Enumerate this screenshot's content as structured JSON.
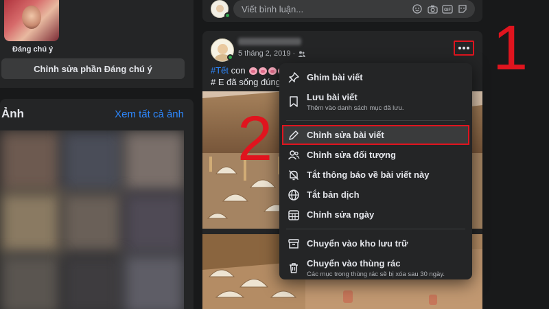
{
  "left": {
    "featured_label": "Đáng chú ý",
    "edit_featured_button": "Chỉnh sửa phần Đáng chú ý",
    "photos_title": "Ảnh",
    "see_all_photos": "Xem tất cả ảnh"
  },
  "prev_post": {
    "comment_placeholder": "Viết bình luận..."
  },
  "post": {
    "date": "5 tháng 2, 2019 ·",
    "text_hashtag": "#Tết",
    "text_line1_rest": " con",
    "text_line2": "# E đã sống đúng v",
    "more_icon": "more-horizontal-icon"
  },
  "menu": {
    "items": [
      {
        "label": "Ghim bài viết",
        "icon": "pin-icon"
      },
      {
        "label": "Lưu bài viết",
        "sub": "Thêm vào danh sách mục đã lưu.",
        "icon": "bookmark-icon"
      },
      {
        "label": "Chỉnh sửa bài viết",
        "icon": "pencil-icon",
        "highlighted": true
      },
      {
        "label": "Chỉnh sửa đối tượng",
        "icon": "audience-icon"
      },
      {
        "label": "Tắt thông báo về bài viết này",
        "icon": "bell-off-icon"
      },
      {
        "label": "Tắt bản dịch",
        "icon": "globe-icon"
      },
      {
        "label": "Chỉnh sửa ngày",
        "icon": "calendar-icon"
      },
      {
        "label": "Chuyển vào kho lưu trữ",
        "icon": "archive-icon"
      },
      {
        "label": "Chuyển vào thùng rác",
        "sub": "Các mục trong thùng rác sẽ bị xóa sau 30 ngày.",
        "icon": "trash-icon"
      }
    ]
  },
  "annotations": {
    "step1": "1",
    "step2": "2"
  },
  "colors": {
    "background": "#18191a",
    "card": "#242526",
    "link": "#2d88ff",
    "annotation": "#e0141e"
  }
}
